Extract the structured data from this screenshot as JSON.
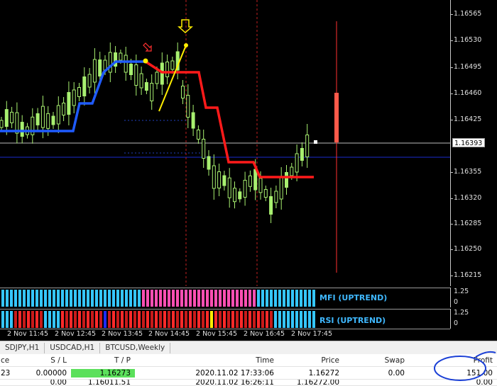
{
  "chart": {
    "price_labels": [
      "1.16565",
      "1.16530",
      "1.16495",
      "1.16460",
      "1.16425",
      "1.16355",
      "1.16320",
      "1.16285",
      "1.16250",
      "1.16215"
    ],
    "current_price": "1.16393",
    "time_labels": [
      "2 Nov 11:45",
      "2 Nov 12:45",
      "2 Nov 13:45",
      "2 Nov 14:45",
      "2 Nov 15:45",
      "2 Nov 16:45",
      "2 Nov 17:45"
    ],
    "colors": {
      "background": "#000000",
      "candle": "#a8f070",
      "supertrend_up": "#1f5bff",
      "supertrend_down": "#ff1a1a",
      "trend_line": "#ffee00"
    }
  },
  "indicators": {
    "mfi_label": "MFI (UPTREND)",
    "rsi_label": "RSI (UPTREND)",
    "mfi_axis": "1.25",
    "rsi_axis": "1.25",
    "axis_zero": "0"
  },
  "tabs": [
    "SDJPY,H1",
    "USDCAD,H1",
    "BTCUSD,Weekly"
  ],
  "terminal": {
    "headers": [
      "ce",
      "S / L",
      "T / P",
      "Time",
      "Price",
      "Swap",
      "Profit"
    ],
    "row": [
      "23",
      "0.00000",
      "1.16273",
      "2020.11.02 17:33:06",
      "1.16272",
      "0.00",
      "151.00"
    ],
    "row2": [
      "",
      "0.00",
      "1.16011.51",
      "2020.11.02 16:26:11",
      "1.16272.00",
      "",
      "0.00"
    ]
  }
}
